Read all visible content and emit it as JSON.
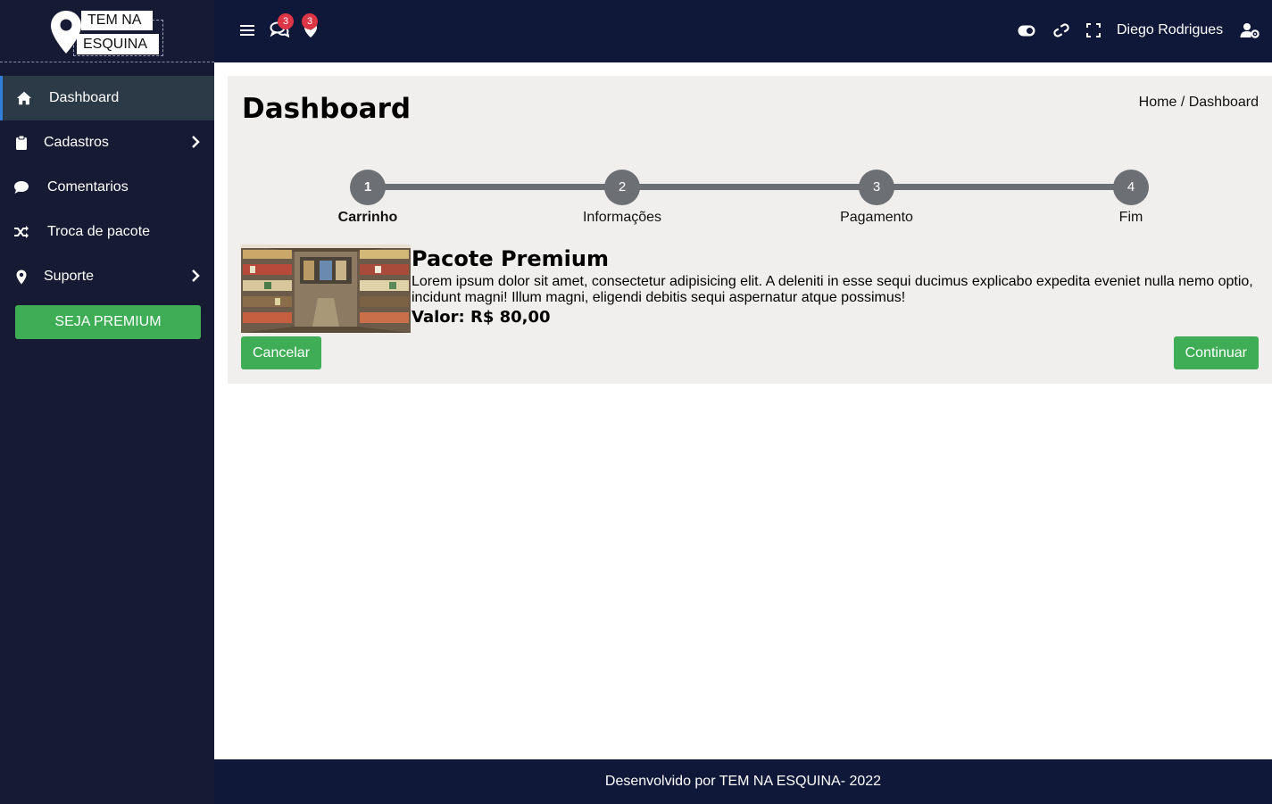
{
  "brand": {
    "line1": "TEM NA",
    "line2": "ESQUINA"
  },
  "sidebar": {
    "items": [
      {
        "label": "Dashboard",
        "icon": "home-icon"
      },
      {
        "label": "Cadastros",
        "icon": "clipboard-icon",
        "has_submenu": true
      },
      {
        "label": "Comentarios",
        "icon": "comment-icon"
      },
      {
        "label": "Troca de pacote",
        "icon": "shuffle-icon"
      },
      {
        "label": "Suporte",
        "icon": "map-pin-icon",
        "has_submenu": true
      }
    ],
    "premium_button": "SEJA PREMIUM"
  },
  "topbar": {
    "menu_icon": "hamburger-icon",
    "comments_badge": "3",
    "notifications_badge": "3",
    "user_name": "Diego Rodrigues"
  },
  "main": {
    "title": "Dashboard",
    "breadcrumb": {
      "home": "Home",
      "separator": "/",
      "current": "Dashboard"
    },
    "steps": [
      {
        "number": "1",
        "label": "Carrinho",
        "active": true
      },
      {
        "number": "2",
        "label": "Informações"
      },
      {
        "number": "3",
        "label": "Pagamento"
      },
      {
        "number": "4",
        "label": "Fim"
      }
    ],
    "product": {
      "title": "Pacote Premium",
      "description": "Lorem ipsum dolor sit amet, consectetur adipisicing elit. A deleniti in esse sequi ducimus explicabo expedita eveniet nulla nemo optio, incidunt magni! Illum magni, eligendi debitis sequi aspernatur atque possimus!",
      "price": "Valor: R$ 80,00"
    },
    "cancel_label": "Cancelar",
    "continue_label": "Continuar"
  },
  "footer": {
    "text": "Desenvolvido por TEM NA ESQUINA- 2022"
  },
  "colors": {
    "sidebar_bg": "#161b33",
    "topbar_bg": "#0f1838",
    "accent_green": "#3fad56",
    "badge_red": "#dc3545",
    "step_gray": "#6c7075",
    "card_bg": "#f1efee"
  }
}
